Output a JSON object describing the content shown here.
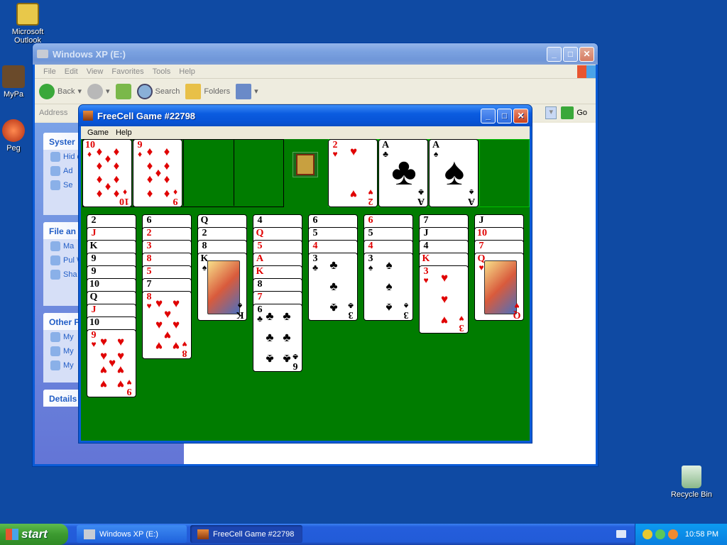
{
  "desktop": {
    "icons": [
      {
        "label": "Microsoft Outlook",
        "line1": "Microsoft",
        "line2": "Outlook"
      },
      {
        "label": "MyPa"
      },
      {
        "label": "Peg"
      },
      {
        "label": "Recycle Bin"
      }
    ]
  },
  "explorer": {
    "title": "Windows XP (E:)",
    "menu": [
      "File",
      "Edit",
      "View",
      "Favorites",
      "Tools",
      "Help"
    ],
    "toolbar": {
      "back": "Back",
      "search": "Search",
      "folders": "Folders"
    },
    "address_label": "Address",
    "go_label": "Go",
    "panels": [
      {
        "title": "Syster",
        "items": [
          "Hid dri",
          "Ad",
          "Se"
        ]
      },
      {
        "title": "File an",
        "items": [
          "Ma",
          "Pul We",
          "Sha"
        ]
      },
      {
        "title": "Other P",
        "items": [
          "My",
          "My",
          "My"
        ]
      },
      {
        "title": "Details",
        "items": []
      }
    ]
  },
  "freecell": {
    "title": "FreeCell Game #22798",
    "menu": [
      "Game",
      "Help"
    ],
    "free_cells": [
      {
        "rank": "10",
        "suit": "♦",
        "color": "red"
      },
      {
        "rank": "9",
        "suit": "♦",
        "color": "red"
      },
      null,
      null
    ],
    "home_cells": [
      {
        "rank": "2",
        "suit": "♥",
        "color": "red"
      },
      {
        "rank": "A",
        "suit": "♣",
        "color": "black"
      },
      {
        "rank": "A",
        "suit": "♠",
        "color": "black"
      },
      null
    ],
    "columns": [
      [
        {
          "r": "2",
          "s": "♠"
        },
        {
          "r": "J",
          "s": "♦"
        },
        {
          "r": "K",
          "s": "♠"
        },
        {
          "r": "9",
          "s": "♠"
        },
        {
          "r": "9",
          "s": "♣"
        },
        {
          "r": "10",
          "s": "♠"
        },
        {
          "r": "Q",
          "s": "♣"
        },
        {
          "r": "J",
          "s": "♦"
        },
        {
          "r": "10",
          "s": "♣"
        },
        {
          "r": "9",
          "s": "♥"
        }
      ],
      [
        {
          "r": "6",
          "s": "♠"
        },
        {
          "r": "2",
          "s": "♦"
        },
        {
          "r": "3",
          "s": "♦"
        },
        {
          "r": "8",
          "s": "♦"
        },
        {
          "r": "5",
          "s": "♦"
        },
        {
          "r": "7",
          "s": "♠"
        },
        {
          "r": "8",
          "s": "♥"
        }
      ],
      [
        {
          "r": "Q",
          "s": "♣"
        },
        {
          "r": "2",
          "s": "♣"
        },
        {
          "r": "8",
          "s": "♣"
        },
        {
          "r": "K",
          "s": "♠"
        }
      ],
      [
        {
          "r": "4",
          "s": "♠"
        },
        {
          "r": "Q",
          "s": "♥"
        },
        {
          "r": "5",
          "s": "♥"
        },
        {
          "r": "A",
          "s": "♦"
        },
        {
          "r": "K",
          "s": "♥"
        },
        {
          "r": "8",
          "s": "♠"
        },
        {
          "r": "7",
          "s": "♦"
        },
        {
          "r": "6",
          "s": "♣"
        }
      ],
      [
        {
          "r": "6",
          "s": "♠"
        },
        {
          "r": "5",
          "s": "♣"
        },
        {
          "r": "4",
          "s": "♦"
        },
        {
          "r": "3",
          "s": "♣"
        }
      ],
      [
        {
          "r": "6",
          "s": "♥"
        },
        {
          "r": "5",
          "s": "♠"
        },
        {
          "r": "4",
          "s": "♦"
        },
        {
          "r": "3",
          "s": "♠"
        }
      ],
      [
        {
          "r": "7",
          "s": "♠"
        },
        {
          "r": "J",
          "s": "♣"
        },
        {
          "r": "4",
          "s": "♣"
        },
        {
          "r": "K",
          "s": "♥"
        },
        {
          "r": "3",
          "s": "♥"
        }
      ],
      [
        {
          "r": "J",
          "s": "♠"
        },
        {
          "r": "10",
          "s": "♥"
        },
        {
          "r": "7",
          "s": "♥"
        },
        {
          "r": "Q",
          "s": "♥"
        }
      ]
    ],
    "felt_color": "#007c00"
  },
  "taskbar": {
    "start_label": "start",
    "buttons": [
      {
        "label": "Windows XP (E:)"
      },
      {
        "label": "FreeCell Game #22798"
      }
    ],
    "clock": "10:58 PM"
  }
}
